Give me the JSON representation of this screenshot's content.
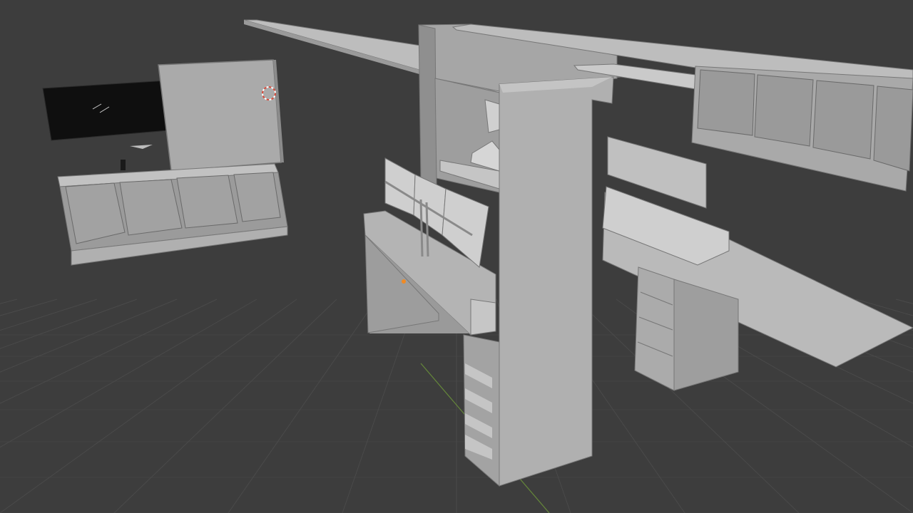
{
  "app": {
    "view": "3D viewport",
    "shading": "solid"
  },
  "colors": {
    "background": "#3d3d3d",
    "grid_line": "#4a4a4a",
    "axis_y": "#6f9a3a",
    "object_light": "#b8b8b8",
    "object_mid": "#a8a8a8",
    "object_dark": "#8e8e8e",
    "edge": "#6a6a6a",
    "screen_black": "#0f0f0f",
    "origin_dot": "#f08a24",
    "cursor_ring_red": "#d94a3a",
    "cursor_ring_white": "#ffffff"
  },
  "scene": {
    "objects": [
      {
        "name": "left-tv-screen",
        "kind": "mesh"
      },
      {
        "name": "left-whiteboard-panel",
        "kind": "mesh"
      },
      {
        "name": "left-low-cabinet",
        "kind": "mesh"
      },
      {
        "name": "center-tall-cabinet",
        "kind": "mesh"
      },
      {
        "name": "center-shelf-unit",
        "kind": "mesh"
      },
      {
        "name": "desk-with-monitors",
        "kind": "mesh"
      },
      {
        "name": "right-wall-shelf",
        "kind": "mesh"
      },
      {
        "name": "right-desk-with-drawers",
        "kind": "mesh"
      },
      {
        "name": "top-beam",
        "kind": "mesh"
      }
    ]
  }
}
